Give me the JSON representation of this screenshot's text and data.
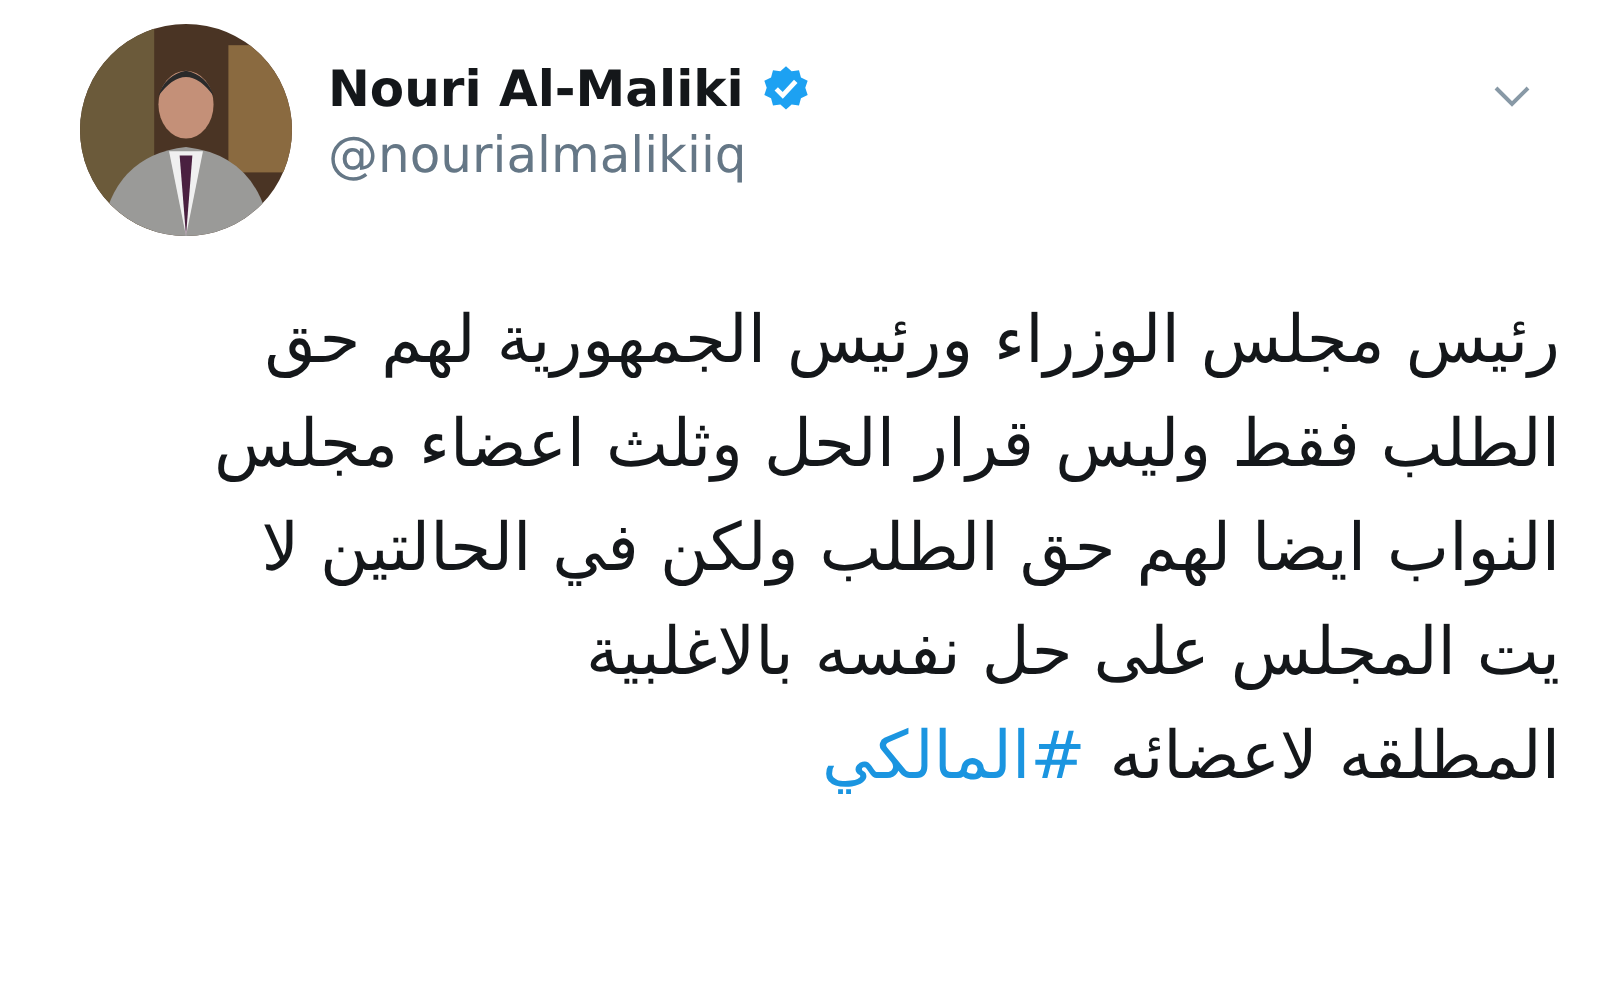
{
  "author": {
    "name": "Nouri Al-Maliki",
    "verified": true,
    "handle": "@nourialmalikiiq"
  },
  "tweet": {
    "lines": [
      "رئيس مجلس الوزراء ورئيس الجمهورية لهم حق",
      "الطلب فقط وليس قرار الحل وثلث اعضاء  مجلس",
      "النواب ايضا لهم حق الطلب ولكن في الحالتين لا",
      "يت المجلس على حل نفسه بالاغلبية",
      "المطلقه لاعضائه"
    ],
    "hashtag": "#المالكي"
  }
}
